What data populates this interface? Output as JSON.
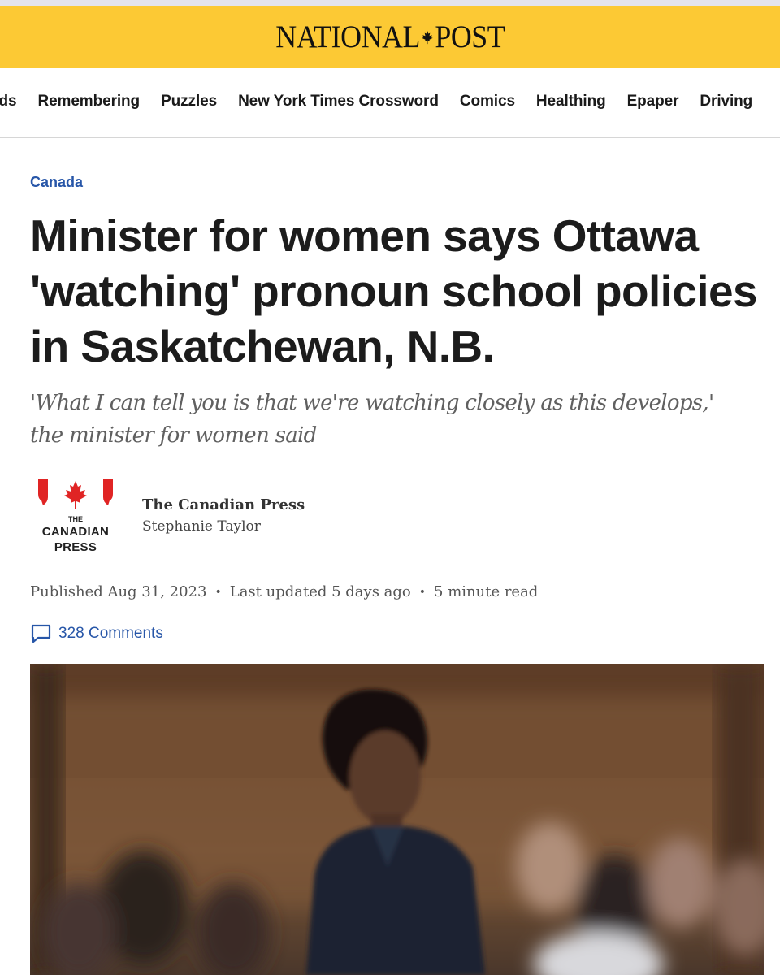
{
  "masthead": {
    "logo_left": "NATIONAL",
    "logo_right": "POST",
    "logo_icon": "maple-leaf-icon",
    "background": "#fcc934"
  },
  "nav": {
    "items": [
      {
        "label": "ads"
      },
      {
        "label": "Remembering"
      },
      {
        "label": "Puzzles"
      },
      {
        "label": "New York Times Crossword"
      },
      {
        "label": "Comics"
      },
      {
        "label": "Healthing"
      },
      {
        "label": "Epaper"
      },
      {
        "label": "Driving"
      }
    ]
  },
  "article": {
    "category": "Canada",
    "headline": "Minister for women says Ottawa 'watching' pronoun school policies in Saskatchewan, N.B.",
    "deck": "'What I can tell you is that we're watching closely as this develops,' the minister for women said",
    "byline": {
      "logo": {
        "the": "THE",
        "line1": "CANADIAN",
        "line2": "PRESS",
        "icon": "maple-leaf-icon",
        "color": "#e02424"
      },
      "source": "The Canadian Press",
      "author": "Stephanie Taylor"
    },
    "meta": {
      "published": "Published Aug 31, 2023",
      "updated": "Last updated 5 days ago",
      "read_time": "5 minute read",
      "separator": "•"
    },
    "comments": {
      "label": "328 Comments",
      "icon": "comment-bubble-icon"
    },
    "photo": {
      "subject": "woman-in-dark-shirt-speaking"
    }
  },
  "colors": {
    "link_blue": "#2756a8",
    "headline": "#1c1c1c",
    "deck": "#606060"
  }
}
